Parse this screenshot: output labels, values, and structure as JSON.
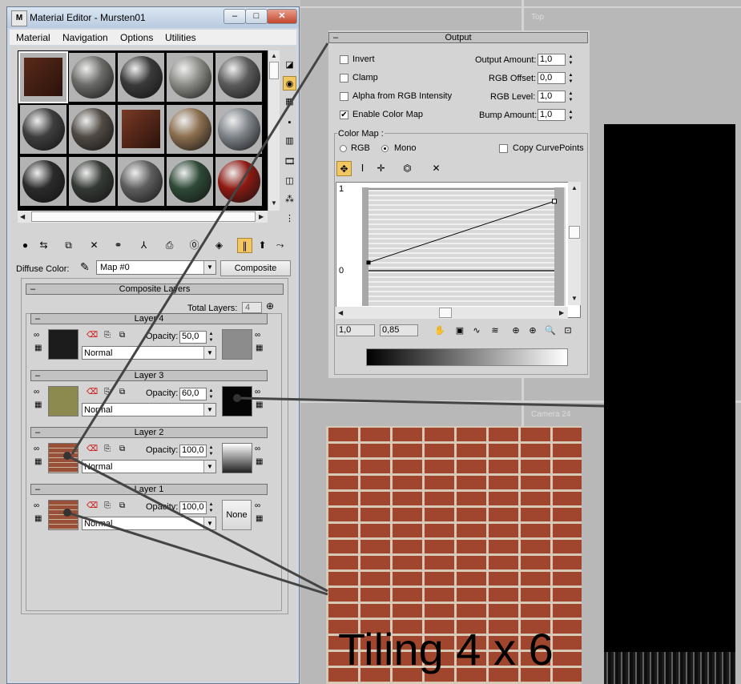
{
  "window": {
    "title": "Material Editor - Mursten01",
    "app_icon_text": "M",
    "minimize_glyph": "–",
    "maximize_glyph": "□",
    "close_glyph": "✕"
  },
  "menu": [
    "Material",
    "Navigation",
    "Options",
    "Utilities"
  ],
  "slots": [
    {
      "shape": "cube",
      "color": "#5a2a1a"
    },
    {
      "shape": "sphere",
      "color": "#6b6b68"
    },
    {
      "shape": "sphere",
      "color": "#3a3a3a"
    },
    {
      "shape": "sphere",
      "color": "#8d8d88"
    },
    {
      "shape": "sphere",
      "color": "#5c5c5c"
    },
    {
      "shape": "sphere",
      "color": "#3e3e3e"
    },
    {
      "shape": "sphere",
      "color": "#514a44"
    },
    {
      "shape": "cube",
      "color": "#7a3a26"
    },
    {
      "shape": "sphere",
      "color": "#8c6f4f"
    },
    {
      "shape": "sphere",
      "color": "#7e848a"
    },
    {
      "shape": "sphere",
      "color": "#2b2b2b"
    },
    {
      "shape": "sphere",
      "color": "#353a35"
    },
    {
      "shape": "sphere",
      "color": "#5e5e5e"
    },
    {
      "shape": "sphere",
      "color": "#2e4a36"
    },
    {
      "shape": "sphere",
      "color": "#8f1a12"
    }
  ],
  "side_tools": [
    "sample-type-icon",
    "backlight-icon",
    "background-checker-icon",
    "sample-uv-tiling-icon",
    "video-color-check-icon",
    "make-preview-icon",
    "material-map-options-icon",
    "select-by-material-icon",
    "material-map-navigator-icon"
  ],
  "diffuse": {
    "label": "Diffuse Color:",
    "map_name": "Map #0",
    "type_button": "Composite"
  },
  "composite": {
    "header": "Composite Layers",
    "total_label": "Total Layers:",
    "total_value": "4",
    "opacity_label": "Opacity:",
    "layers": [
      {
        "title": "Layer 4",
        "opacity": "50,0",
        "blend": "Normal",
        "swatch": "#1c1c1c",
        "mask": "#8c8c8c"
      },
      {
        "title": "Layer 3",
        "opacity": "60,0",
        "blend": "Normal",
        "swatch": "#8c8a4e",
        "mask": "#050505"
      },
      {
        "title": "Layer 2",
        "opacity": "100,0",
        "blend": "Normal",
        "swatch": "#9a5038",
        "mask": "gradient"
      },
      {
        "title": "Layer 1",
        "opacity": "100,0",
        "blend": "Normal",
        "swatch": "#9a5038",
        "mask": "none",
        "mask_label": "None"
      }
    ]
  },
  "output": {
    "header": "Output",
    "invert": {
      "label": "Invert",
      "checked": false
    },
    "clamp": {
      "label": "Clamp",
      "checked": false
    },
    "alpha_rgb": {
      "label": "Alpha from RGB Intensity",
      "checked": false
    },
    "enable_color_map": {
      "label": "Enable Color Map",
      "checked": true
    },
    "output_amount": {
      "label": "Output Amount:",
      "value": "1,0"
    },
    "rgb_offset": {
      "label": "RGB Offset:",
      "value": "0,0"
    },
    "rgb_level": {
      "label": "RGB Level:",
      "value": "1,0"
    },
    "bump_amount": {
      "label": "Bump Amount:",
      "value": "1,0"
    },
    "color_map": {
      "label": "Color Map :",
      "rgb_label": "RGB",
      "mono_label": "Mono",
      "mode": "Mono",
      "copy_curvepoints": {
        "label": "Copy CurvePoints",
        "checked": false
      },
      "y_top": "1",
      "y_zero": "0",
      "coord_x": "1,0",
      "coord_y": "0,85",
      "curve_points": [
        [
          0,
          0.1
        ],
        [
          1,
          0.85
        ]
      ]
    }
  },
  "preview": {
    "tiling_text": "Tiling 4 x 6"
  },
  "viewport": {
    "top_label": "Top",
    "camera_label": "Camera 24"
  },
  "colors": {
    "active_tool": "#f2c660",
    "titlebar": "#c9d8ea",
    "panel": "#d4d4d4"
  }
}
